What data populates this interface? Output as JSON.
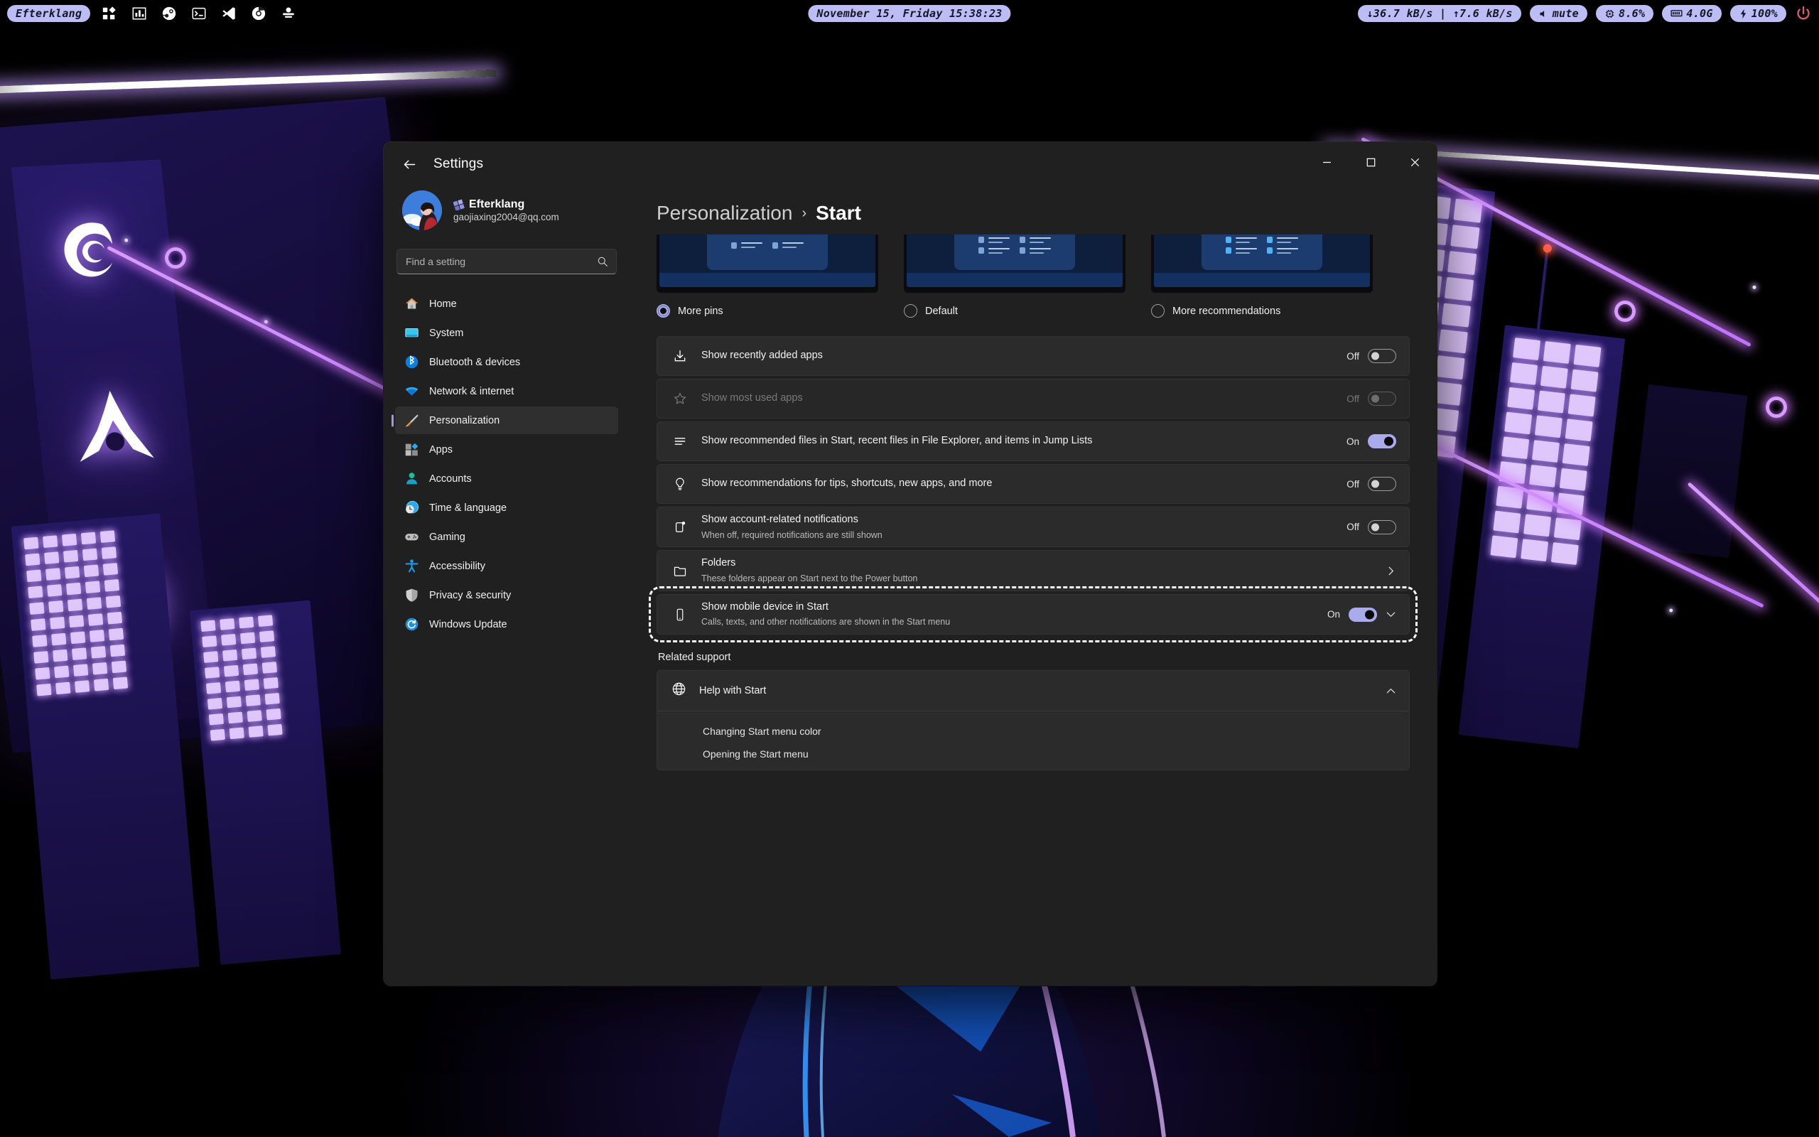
{
  "topbar": {
    "workspace_label": "Efterklang",
    "tray_icons": [
      "apps-grid-icon",
      "stats-chart-icon",
      "steam-icon",
      "terminal-icon",
      "vscode-icon",
      "chrome-icon",
      "printer-icon"
    ],
    "clock": "November 15, Friday 15:38:23",
    "network": "↓36.7 kB/s | ↑7.6 kB/s",
    "volume": "mute",
    "cpu": "8.6%",
    "memory": "4.0G",
    "battery": "100%",
    "accent": "#bdbdf5"
  },
  "window": {
    "title": "Settings",
    "back_label": "Back",
    "minimize_label": "Minimize",
    "maximize_label": "Maximize",
    "close_label": "Close"
  },
  "account": {
    "name": "Efterklang",
    "email": "gaojiaxing2004@qq.com"
  },
  "search": {
    "placeholder": "Find a setting",
    "value": ""
  },
  "sidebar": {
    "items": [
      {
        "label": "Home",
        "icon": "home-icon",
        "active": false
      },
      {
        "label": "System",
        "icon": "system-icon",
        "active": false
      },
      {
        "label": "Bluetooth & devices",
        "icon": "bluetooth-icon",
        "active": false
      },
      {
        "label": "Network & internet",
        "icon": "network-icon",
        "active": false
      },
      {
        "label": "Personalization",
        "icon": "personalization-icon",
        "active": true
      },
      {
        "label": "Apps",
        "icon": "apps-icon",
        "active": false
      },
      {
        "label": "Accounts",
        "icon": "accounts-icon",
        "active": false
      },
      {
        "label": "Time & language",
        "icon": "time-icon",
        "active": false
      },
      {
        "label": "Gaming",
        "icon": "gaming-icon",
        "active": false
      },
      {
        "label": "Accessibility",
        "icon": "accessibility-icon",
        "active": false
      },
      {
        "label": "Privacy & security",
        "icon": "privacy-icon",
        "active": false
      },
      {
        "label": "Windows Update",
        "icon": "update-icon",
        "active": false
      }
    ]
  },
  "breadcrumb": {
    "parent": "Personalization",
    "separator": "›",
    "current": "Start"
  },
  "layout": {
    "options": [
      {
        "label": "More pins",
        "selected": true
      },
      {
        "label": "Default",
        "selected": false
      },
      {
        "label": "More recommendations",
        "selected": false
      }
    ]
  },
  "settings_rows": [
    {
      "title": "Show recently added apps",
      "subtitle": "",
      "icon": "download-icon",
      "state_label": "Off",
      "on": false,
      "disabled": false,
      "focused": false
    },
    {
      "title": "Show most used apps",
      "subtitle": "",
      "icon": "star-icon",
      "state_label": "Off",
      "on": false,
      "disabled": true,
      "focused": false
    },
    {
      "title": "Show recommended files in Start, recent files in File Explorer, and items in Jump Lists",
      "subtitle": "",
      "icon": "list-icon",
      "state_label": "On",
      "on": true,
      "disabled": false,
      "focused": false
    },
    {
      "title": "Show recommendations for tips, shortcuts, new apps, and more",
      "subtitle": "",
      "icon": "lightbulb-icon",
      "state_label": "Off",
      "on": false,
      "disabled": false,
      "focused": false
    },
    {
      "title": "Show account-related notifications",
      "subtitle": "When off, required notifications are still shown",
      "icon": "account-notification-icon",
      "state_label": "Off",
      "on": false,
      "disabled": false,
      "focused": false
    },
    {
      "title": "Folders",
      "subtitle": "These folders appear on Start next to the Power button",
      "icon": "folder-icon",
      "state_label": "",
      "on": null,
      "disabled": false,
      "focused": false,
      "chevron": "right"
    },
    {
      "title": "Show mobile device in Start",
      "subtitle": "Calls, texts, and other notifications are shown in the Start menu",
      "icon": "mobile-device-icon",
      "state_label": "On",
      "on": true,
      "disabled": false,
      "focused": true,
      "chevron": "down"
    }
  ],
  "related_support": {
    "section_title": "Related support",
    "help_title": "Help with Start",
    "help_icon": "help-globe-icon",
    "expanded": true,
    "links": [
      "Changing Start menu color",
      "Opening the Start menu"
    ]
  }
}
